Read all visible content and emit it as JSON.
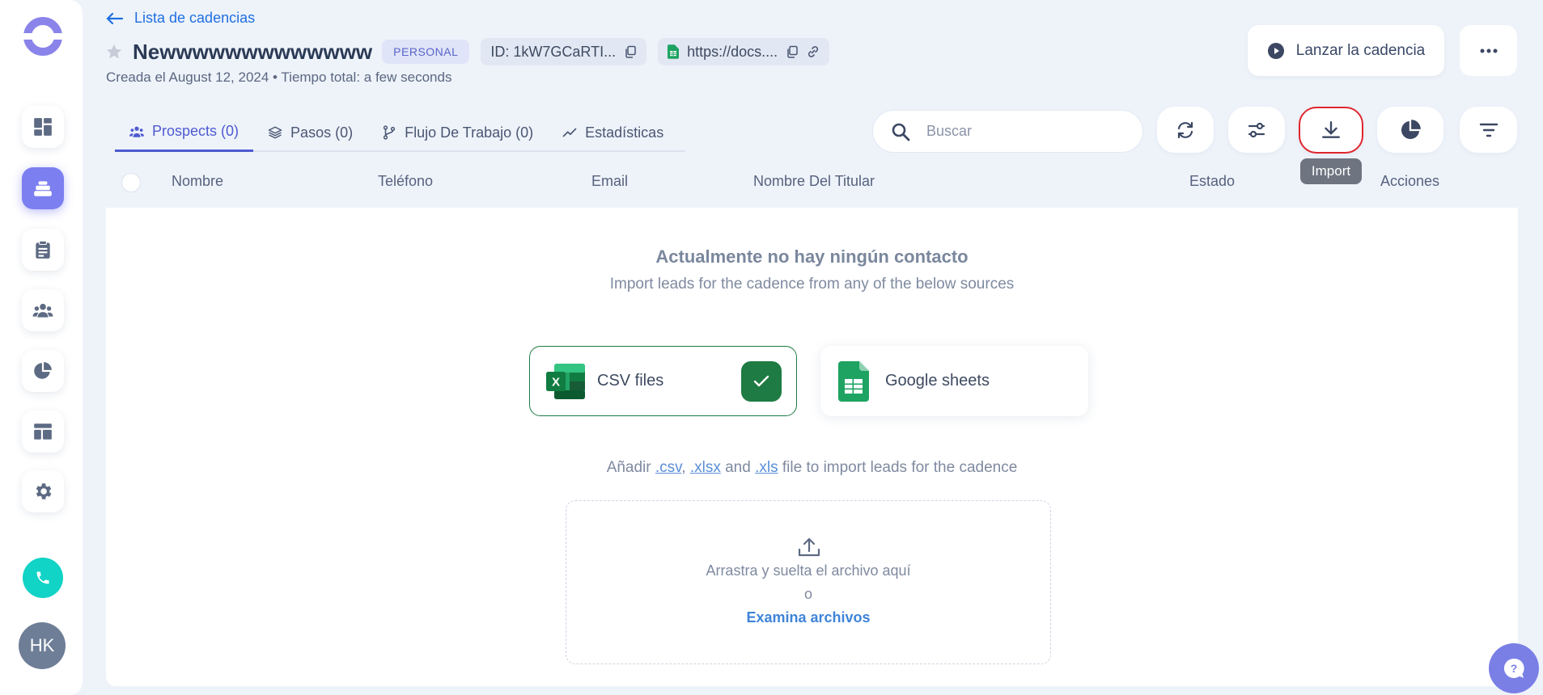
{
  "header": {
    "back_label": "Lista de cadencias",
    "title": "Newwwwwwwwwwwww",
    "badge": "PERSONAL",
    "id_chip": "ID: 1kW7GCaRTI...",
    "link_chip": "https://docs....",
    "subline": "Creada el August 12, 2024 • Tiempo total: a few seconds",
    "launch_label": "Lanzar la cadencia"
  },
  "tabs": [
    {
      "label": "Prospects (0)",
      "icon": "users-icon",
      "active": true
    },
    {
      "label": "Pasos (0)",
      "icon": "layers-icon",
      "active": false
    },
    {
      "label": "Flujo De Trabajo (0)",
      "icon": "workflow-icon",
      "active": false
    },
    {
      "label": "Estadísticas",
      "icon": "trend-icon",
      "active": false
    }
  ],
  "toolbar": {
    "search_placeholder": "Buscar",
    "tooltip": "Import"
  },
  "table": {
    "columns": [
      "Nombre",
      "Teléfono",
      "Email",
      "Nombre Del Titular",
      "Estado",
      "Acciones"
    ]
  },
  "empty": {
    "title": "Actualmente no hay ningún contacto",
    "subtitle": "Import leads for the cadence from any of the below sources",
    "csv_label": "CSV files",
    "gs_label": "Google sheets",
    "hint_prefix": "Añadir ",
    "hint_csv": ".csv",
    "hint_sep": ", ",
    "hint_xlsx": ".xlsx",
    "hint_and": " and ",
    "hint_xls": ".xls",
    "hint_suffix": " file to import leads for the cadence",
    "drop_text": "Arrastra y suelta el archivo aquí",
    "or_text": "o",
    "browse_link": "Examina archivos"
  },
  "user": {
    "initials": "HK"
  },
  "colors": {
    "accent": "#4e5ad0",
    "link": "#1f6fe0",
    "csv_green": "#1e7b43",
    "phone": "#11d3c6",
    "highlight": "#e0262f"
  }
}
